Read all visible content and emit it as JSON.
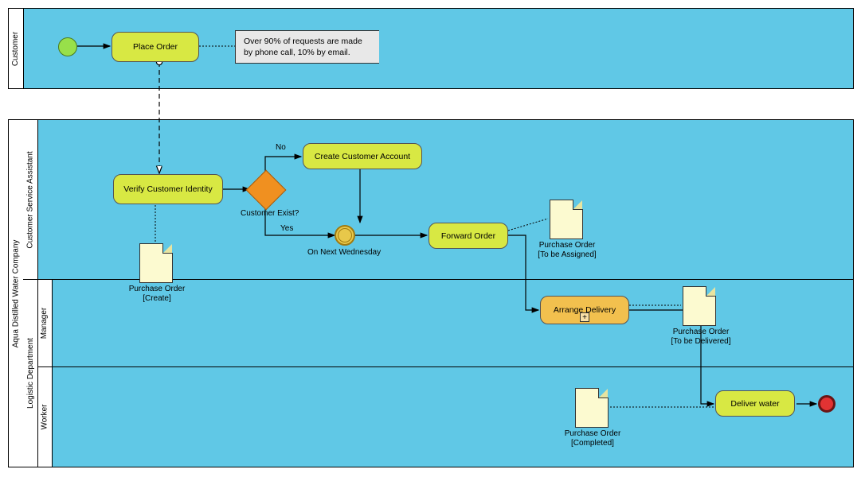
{
  "pool1": {
    "name": "Customer"
  },
  "pool2": {
    "name": "Aqua Distilled Water Company",
    "lanes": {
      "csa": "Customer Service Assistant",
      "ld": "Logistic Department",
      "mgr": "Manager",
      "wrk": "Worker"
    }
  },
  "tasks": {
    "placeOrder": "Place Order",
    "verify": "Verify Customer Identity",
    "createAcc": "Create Customer Account",
    "forward": "Forward Order",
    "arrange": "Arrange Delivery",
    "deliver": "Deliver water"
  },
  "gateway": {
    "label": "Customer Exist?"
  },
  "flows": {
    "no": "No",
    "yes": "Yes"
  },
  "timer": {
    "label": "On Next Wednesday"
  },
  "docs": {
    "create": {
      "name": "Purchase Order",
      "state": "[Create]"
    },
    "assigned": {
      "name": "Purchase Order",
      "state": "[To be Assigned]"
    },
    "delivered": {
      "name": "Purchase Order",
      "state": "[To be Delivered]"
    },
    "completed": {
      "name": "Purchase Order",
      "state": "[Completed]"
    }
  },
  "annotation": "Over 90% of requests are made by phone call, 10% by email."
}
